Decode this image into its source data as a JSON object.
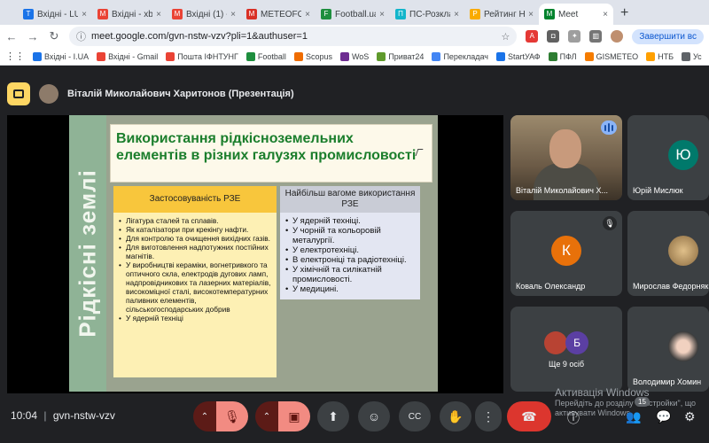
{
  "tabs": [
    {
      "title": "Вхідні - LUA",
      "color": "#1a73e8",
      "letter": "T"
    },
    {
      "title": "Вхідні - xbp",
      "color": "#ea4335",
      "letter": "M"
    },
    {
      "title": "Вхідні (1) -",
      "color": "#ea4335",
      "letter": "M"
    },
    {
      "title": "METEOFOR",
      "color": "#d93025",
      "letter": "M"
    },
    {
      "title": "Football.ua",
      "color": "#1e8e3e",
      "letter": "F"
    },
    {
      "title": "ПС-Розклад",
      "color": "#12b5cb",
      "letter": "П"
    },
    {
      "title": "Рейтинг НІ",
      "color": "#f9ab00",
      "letter": "Р"
    },
    {
      "title": "Meet",
      "color": "#00832d",
      "letter": "M"
    }
  ],
  "address": {
    "url": "meet.google.com/gvn-nstw-vzv?pli=1&authuser=1"
  },
  "end_call_pill": "Завершити вс",
  "bookmarks": [
    {
      "label": "Вхідні - I.UA",
      "color": "#1a73e8"
    },
    {
      "label": "Вхідні - Gmail",
      "color": "#ea4335"
    },
    {
      "label": "Пошта ІФНТУНГ",
      "color": "#ea4335"
    },
    {
      "label": "Football",
      "color": "#1e8e3e"
    },
    {
      "label": "Scopus",
      "color": "#ef6c00"
    },
    {
      "label": "WoS",
      "color": "#6d2c91"
    },
    {
      "label": "Приват24",
      "color": "#5f9a2c"
    },
    {
      "label": "Перекладач",
      "color": "#4285f4"
    },
    {
      "label": "StartУАФ",
      "color": "#1a73e8"
    },
    {
      "label": "ПФЛ",
      "color": "#2e7d32"
    },
    {
      "label": "GISMETEO",
      "color": "#f57c00"
    },
    {
      "label": "НТБ",
      "color": "#ffa000"
    },
    {
      "label": "Ус",
      "color": "#5f6368"
    }
  ],
  "presenter": {
    "name": "Віталій Миколайович Харитонов (Презентація)"
  },
  "slide": {
    "side_text": "Рідкісні землі",
    "title": "Використання рідкісноземельних елементів в різних галузях промисловості",
    "left_header": "Застосовуваність РЗЕ",
    "right_header": "Найбільш вагоме використання РЗЕ",
    "left_items": [
      "Лігатура сталей та сплавів.",
      "Як каталізатори при крекінгу нафти.",
      "Для контролю та очищення вихідних газів.",
      "Для виготовлення надпотужних постійних магнітів.",
      "У виробництві кераміки, вогнетривкого та оптичного скла, електродів дугових ламп, надпровідникових та лазерних матеріалів, високоміцної сталі, високотемпературних паливних елементів, сільськогосподарських добрив",
      "У ядерній техніці"
    ],
    "right_items": [
      "У ядерній техніці.",
      "У чорній та кольоровій металургії.",
      "У електротехніці.",
      "В електроніці та радіотехніці.",
      "У хімічній та силікатній промисловості.",
      "У медицині."
    ]
  },
  "participants": [
    {
      "name": "Віталій Миколайович Х...",
      "type": "webcam",
      "speaking": true
    },
    {
      "name": "Юрій Мислюк",
      "type": "initial",
      "initial": "Ю",
      "color": "#00796b"
    },
    {
      "name": "Коваль Олександр",
      "type": "initial",
      "initial": "К",
      "color": "#e8710a",
      "muted": true
    },
    {
      "name": "Мирослав Федорняк",
      "type": "photo",
      "color": "#c9a66b"
    },
    {
      "more_label": "Ще 9 осіб",
      "more_initial": "Б"
    },
    {
      "name": "Володимир Хомин",
      "type": "photo",
      "color": "#b33b3b"
    }
  ],
  "watermark": {
    "line1": "Активація Windows",
    "line2": "Перейдіть до розділу \"Настройки\", що",
    "line3": "активувати Windows."
  },
  "meeting": {
    "time": "10:04",
    "sep": "|",
    "code": "gvn-nstw-vzv"
  },
  "people_count": "15",
  "icons": {
    "mic": "🎤",
    "camera": "📷",
    "present": "⬆",
    "emoji": "☺",
    "captions": "CC",
    "raise_hand": "✋",
    "more": "⋮",
    "hangup": "☎",
    "people": "👥",
    "chat": "💬",
    "activities": "⚙"
  }
}
